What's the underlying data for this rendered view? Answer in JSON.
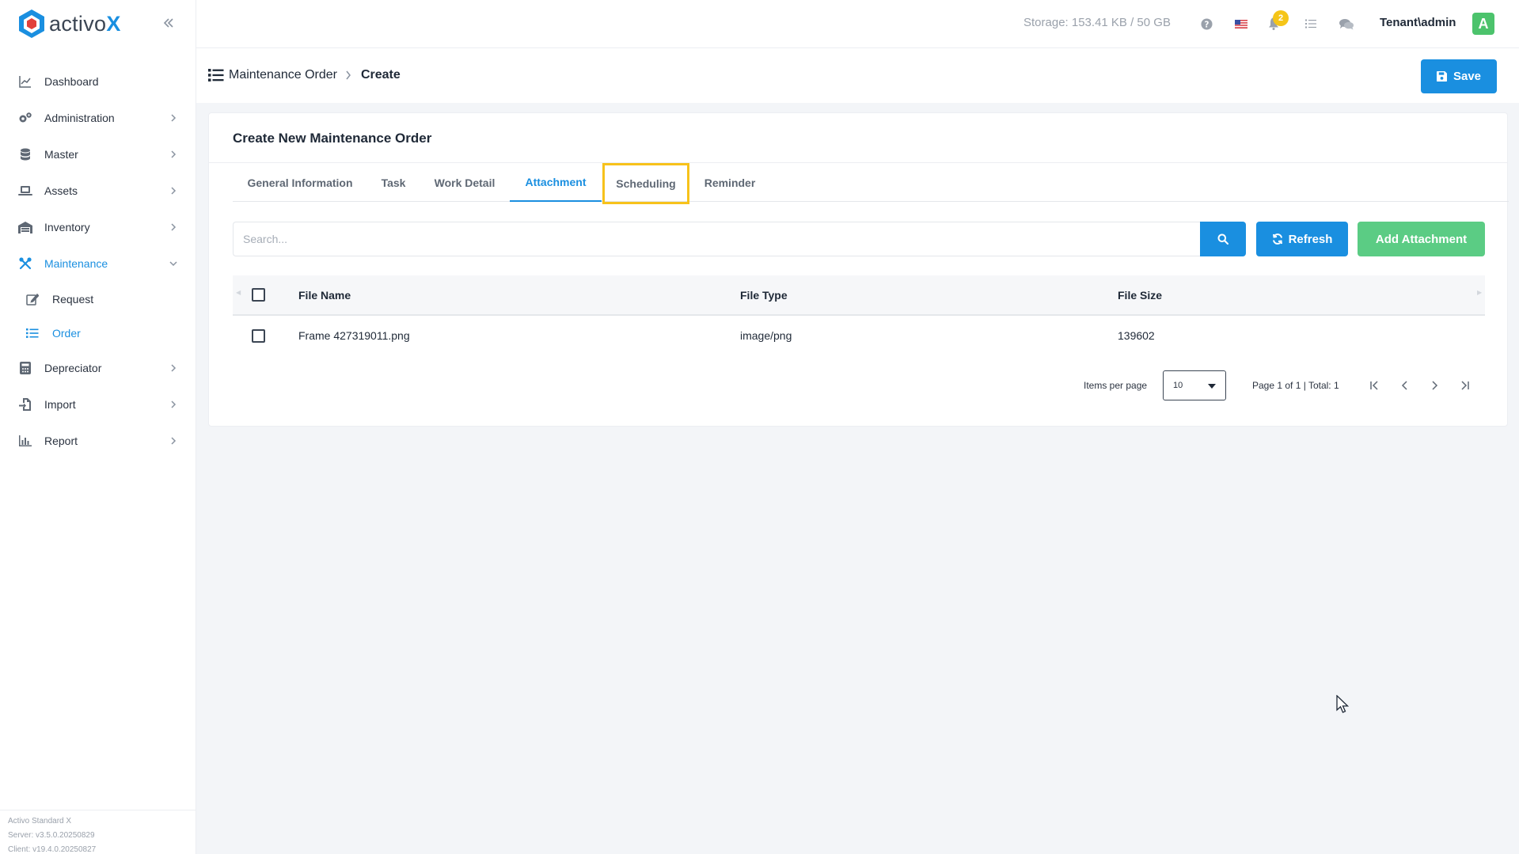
{
  "app": {
    "logo_prefix": "activo",
    "logo_suffix": "X",
    "version_lines": [
      "Activo Standard X",
      "Server: v3.5.0.20250829",
      "Client: v19.4.0.20250827"
    ]
  },
  "sidebar": {
    "items": [
      {
        "label": "Dashboard",
        "icon": "chart-line-icon",
        "has_chevron": false,
        "active": false
      },
      {
        "label": "Administration",
        "icon": "gears-icon",
        "has_chevron": true,
        "active": false
      },
      {
        "label": "Master",
        "icon": "database-icon",
        "has_chevron": true,
        "active": false
      },
      {
        "label": "Assets",
        "icon": "laptop-icon",
        "has_chevron": true,
        "active": false
      },
      {
        "label": "Inventory",
        "icon": "warehouse-icon",
        "has_chevron": true,
        "active": false
      },
      {
        "label": "Maintenance",
        "icon": "tools-icon",
        "has_chevron": true,
        "active": true,
        "expanded": true
      },
      {
        "label": "Depreciator",
        "icon": "calculator-icon",
        "has_chevron": true,
        "active": false
      },
      {
        "label": "Import",
        "icon": "file-import-icon",
        "has_chevron": true,
        "active": false
      },
      {
        "label": "Report",
        "icon": "bar-chart-icon",
        "has_chevron": true,
        "active": false
      }
    ],
    "maintenance_sub": [
      {
        "label": "Request",
        "icon": "edit-icon",
        "active": false
      },
      {
        "label": "Order",
        "icon": "list-icon",
        "active": true
      }
    ]
  },
  "topbar": {
    "storage": "Storage: 153.41 KB / 50 GB",
    "notification_count": "2",
    "user": "Tenant\\admin",
    "avatar_letter": "A"
  },
  "pagehead": {
    "breadcrumb_parent": "Maintenance Order",
    "breadcrumb_current": "Create",
    "save_label": "Save"
  },
  "card": {
    "title": "Create New Maintenance Order",
    "tabs": [
      {
        "label": "General Information",
        "active": false
      },
      {
        "label": "Task",
        "active": false
      },
      {
        "label": "Work Detail",
        "active": false
      },
      {
        "label": "Attachment",
        "active": true
      },
      {
        "label": "Scheduling",
        "active": false,
        "highlighted": true
      },
      {
        "label": "Reminder",
        "active": false
      }
    ],
    "search_placeholder": "Search...",
    "refresh_label": "Refresh",
    "add_label": "Add Attachment",
    "table": {
      "columns": [
        "File Name",
        "File Type",
        "File Size"
      ],
      "rows": [
        {
          "name": "Frame 427319011.png",
          "type": "image/png",
          "size": "139602"
        }
      ]
    },
    "pager": {
      "items_per_page_label": "Items per page",
      "items_per_page_value": "10",
      "page_info": "Page 1 of 1 | Total: 1"
    }
  },
  "colors": {
    "primary": "#1a8fe0",
    "success": "#5bcc84",
    "highlight": "#f7c21b",
    "badge": "#f5c518",
    "avatar": "#4cc36c"
  }
}
